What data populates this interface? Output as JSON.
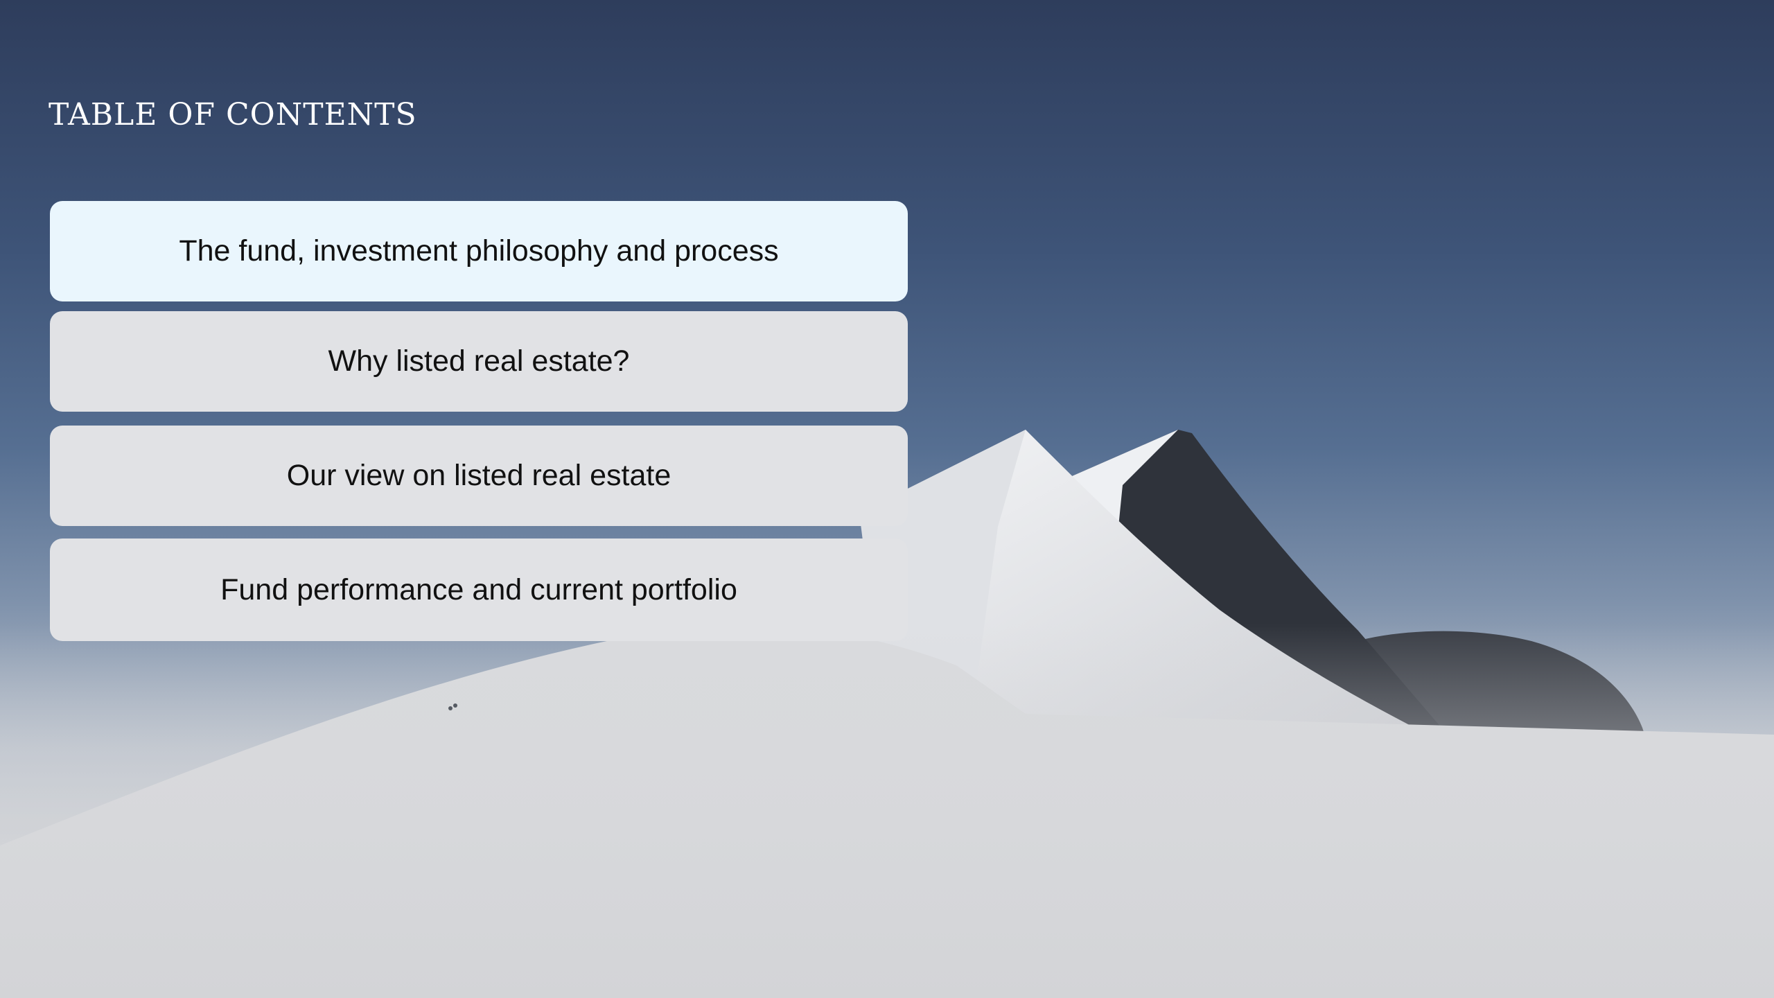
{
  "slide": {
    "title": "TABLE OF CONTENTS",
    "toc_items": [
      {
        "label": "The fund, investment philosophy and process",
        "active": true
      },
      {
        "label": "Why listed real estate?",
        "active": false
      },
      {
        "label": "Our view on listed real estate",
        "active": false
      },
      {
        "label": "Fund performance and current portfolio",
        "active": false
      }
    ]
  },
  "colors": {
    "sky_top": "#2e3d5c",
    "snow": "#d4d5d8",
    "active_item": "#eaf6fd",
    "inactive_item": "#e1e2e5"
  }
}
